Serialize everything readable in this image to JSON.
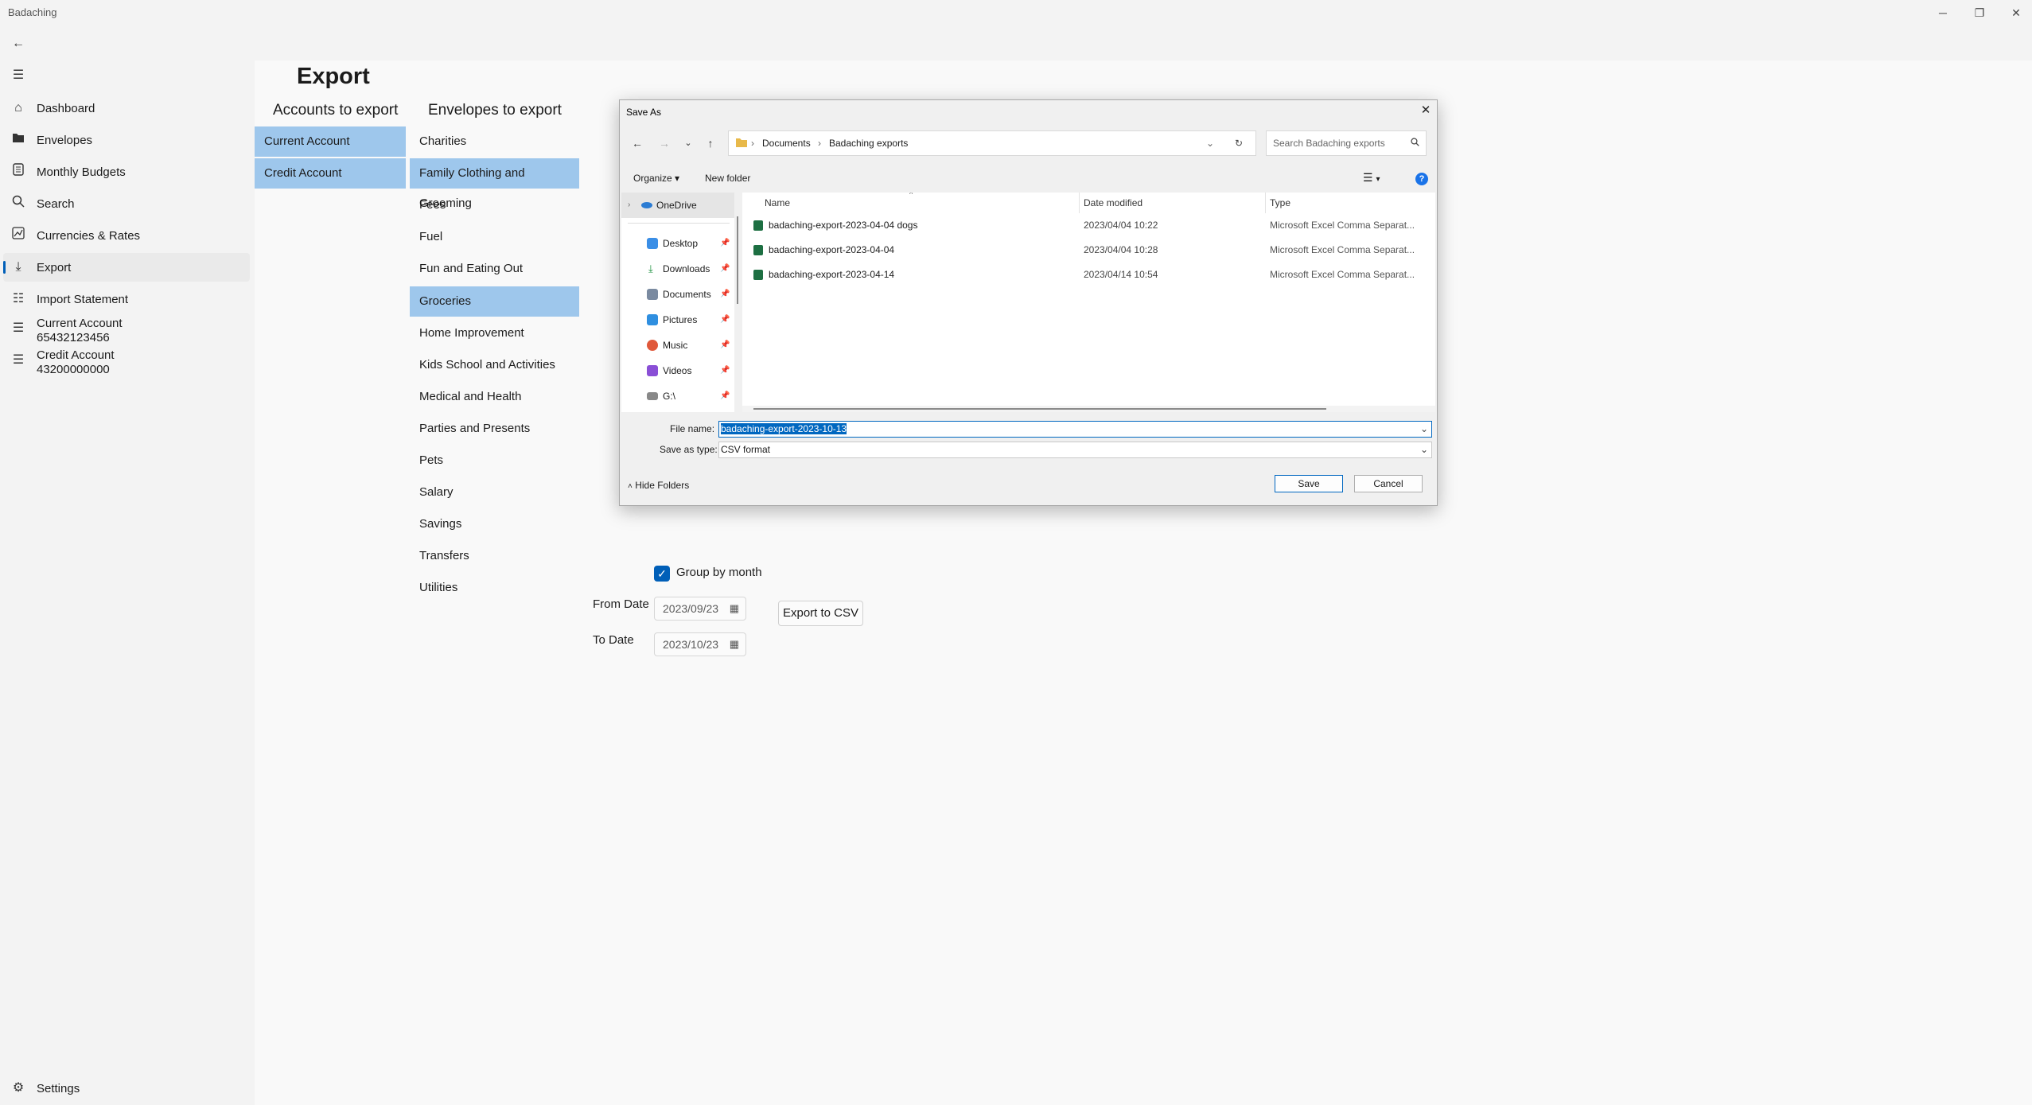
{
  "app": {
    "title": "Badaching"
  },
  "sidebar": {
    "items": [
      {
        "label": "Dashboard",
        "icon": "home-icon"
      },
      {
        "label": "Envelopes",
        "icon": "folder-icon"
      },
      {
        "label": "Monthly Budgets",
        "icon": "budget-icon"
      },
      {
        "label": "Search",
        "icon": "search-icon"
      },
      {
        "label": "Currencies & Rates",
        "icon": "chart-icon"
      },
      {
        "label": "Export",
        "icon": "download-icon"
      },
      {
        "label": "Import Statement",
        "icon": "import-icon"
      },
      {
        "label": "Current Account",
        "sub": "65432123456",
        "icon": "list-icon"
      },
      {
        "label": "Credit Account",
        "sub": "43200000000",
        "icon": "list-icon"
      }
    ],
    "settings_label": "Settings"
  },
  "page": {
    "title": "Export",
    "accounts_header": "Accounts to export",
    "envelopes_header": "Envelopes to export",
    "accounts": [
      {
        "label": "Current Account",
        "selected": true
      },
      {
        "label": "Credit Account",
        "selected": true
      }
    ],
    "envelopes": [
      {
        "label": "Charities",
        "selected": false
      },
      {
        "label": "Family Clothing and Grooming",
        "selected": true
      },
      {
        "label": "Fees",
        "selected": false
      },
      {
        "label": "Fuel",
        "selected": false
      },
      {
        "label": "Fun and Eating Out",
        "selected": false
      },
      {
        "label": "Groceries",
        "selected": true
      },
      {
        "label": "Home Improvement",
        "selected": false
      },
      {
        "label": "Kids School and Activities",
        "selected": false
      },
      {
        "label": "Medical and Health",
        "selected": false
      },
      {
        "label": "Parties and Presents",
        "selected": false
      },
      {
        "label": "Pets",
        "selected": false
      },
      {
        "label": "Salary",
        "selected": false
      },
      {
        "label": "Savings",
        "selected": false
      },
      {
        "label": "Transfers",
        "selected": false
      },
      {
        "label": "Utilities",
        "selected": false
      }
    ],
    "group_by_month_label": "Group by month",
    "from_date_label": "From Date",
    "from_date": "2023/09/23",
    "to_date_label": "To Date",
    "to_date": "2023/10/23",
    "export_button": "Export to CSV"
  },
  "dialog": {
    "title": "Save As",
    "breadcrumb": [
      "Documents",
      "Badaching exports"
    ],
    "search_placeholder": "Search Badaching exports",
    "organize_label": "Organize",
    "new_folder_label": "New folder",
    "nav": [
      {
        "label": "OneDrive",
        "icon": "cloud-icon"
      },
      {
        "label": "Desktop",
        "icon": "desktop-icon"
      },
      {
        "label": "Downloads",
        "icon": "download-icon"
      },
      {
        "label": "Documents",
        "icon": "documents-icon"
      },
      {
        "label": "Pictures",
        "icon": "pictures-icon"
      },
      {
        "label": "Music",
        "icon": "music-icon"
      },
      {
        "label": "Videos",
        "icon": "videos-icon"
      },
      {
        "label": "G:\\",
        "icon": "drive-icon"
      }
    ],
    "columns": {
      "name": "Name",
      "date": "Date modified",
      "type": "Type"
    },
    "files": [
      {
        "name": "badaching-export-2023-04-04 dogs",
        "date": "2023/04/04 10:22",
        "type": "Microsoft Excel Comma Separat..."
      },
      {
        "name": "badaching-export-2023-04-04",
        "date": "2023/04/04 10:28",
        "type": "Microsoft Excel Comma Separat..."
      },
      {
        "name": "badaching-export-2023-04-14",
        "date": "2023/04/14 10:54",
        "type": "Microsoft Excel Comma Separat..."
      }
    ],
    "file_name_label": "File name:",
    "file_name_value": "badaching-export-2023-10-13",
    "save_type_label": "Save as type:",
    "save_type_value": "CSV format",
    "hide_folders_label": "Hide Folders",
    "save_label": "Save",
    "cancel_label": "Cancel"
  },
  "colors": {
    "accent": "#005fb8",
    "selection": "#9ec7ec",
    "excel_green": "#1d6f42"
  }
}
